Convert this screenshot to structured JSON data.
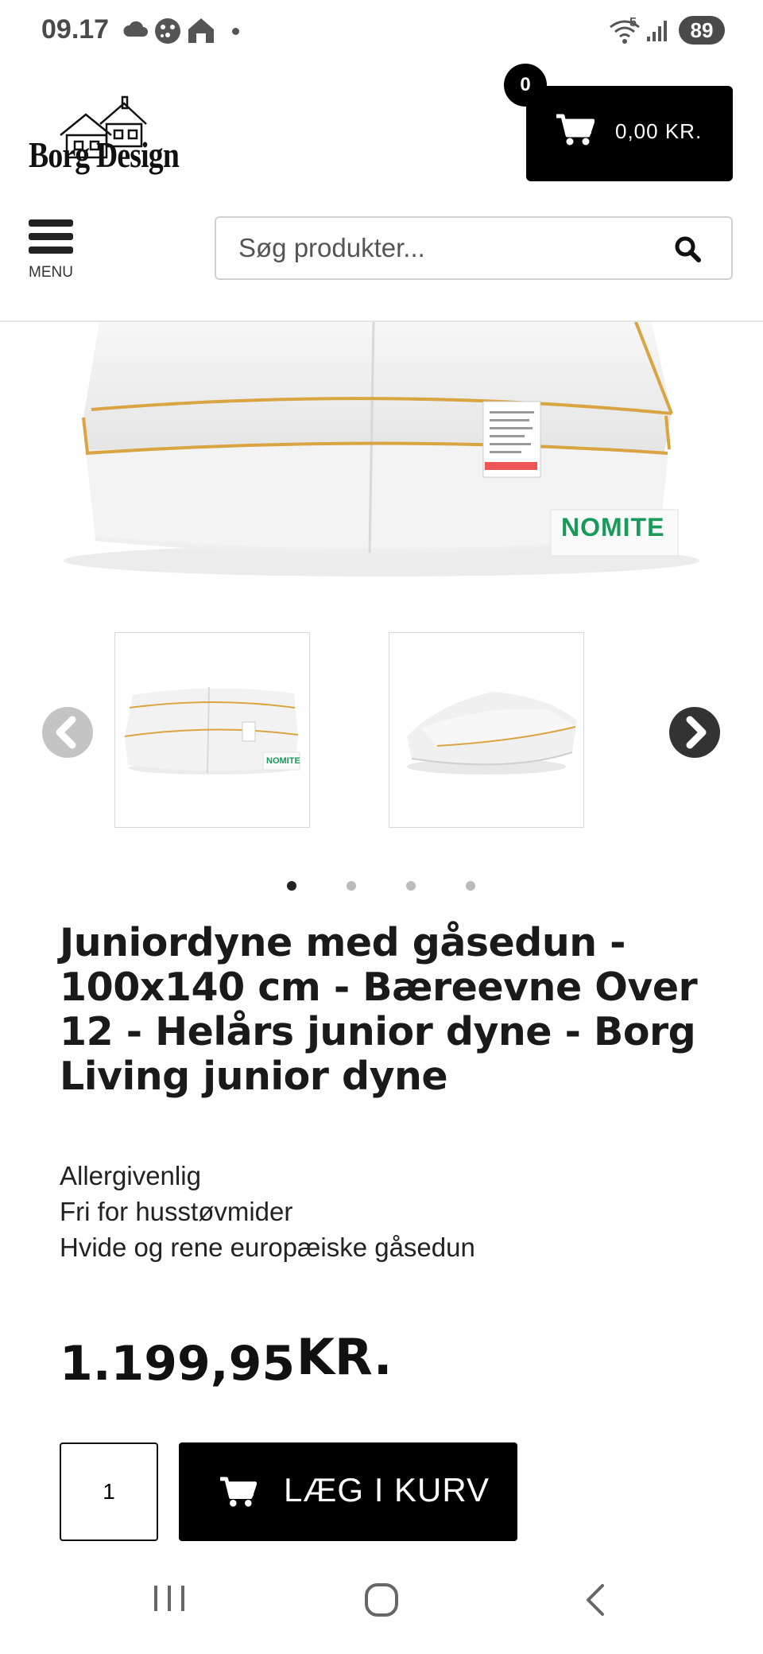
{
  "status_bar": {
    "time": "09.17",
    "battery": "89",
    "signal_sup": "5"
  },
  "header": {
    "logo_text": "Borg Design",
    "cart_total": "0,00  KR.",
    "cart_count": "0",
    "menu_label": "MENU",
    "search_placeholder": "Søg produkter..."
  },
  "gallery": {
    "hero_badge": "NOMITE",
    "thumb_badge": "NOMITE",
    "dots": 4,
    "active_dot": 0
  },
  "product": {
    "title": "Juniordyne med gåsedun - 100x140 cm - Bæreevne Over 12 - Helårs junior dyne - Borg Living junior dyne",
    "features": [
      "Allergivenlig",
      "Fri for husstøvmider",
      "Hvide og rene europæiske gåsedun"
    ],
    "price": "1.199,95",
    "currency": "KR.",
    "quantity": "1",
    "add_to_cart_label": "LÆG I KURV"
  },
  "colors": {
    "brand_black": "#000000",
    "piping_gold": "#d9a441",
    "nomite_green": "#1a9a5a"
  }
}
